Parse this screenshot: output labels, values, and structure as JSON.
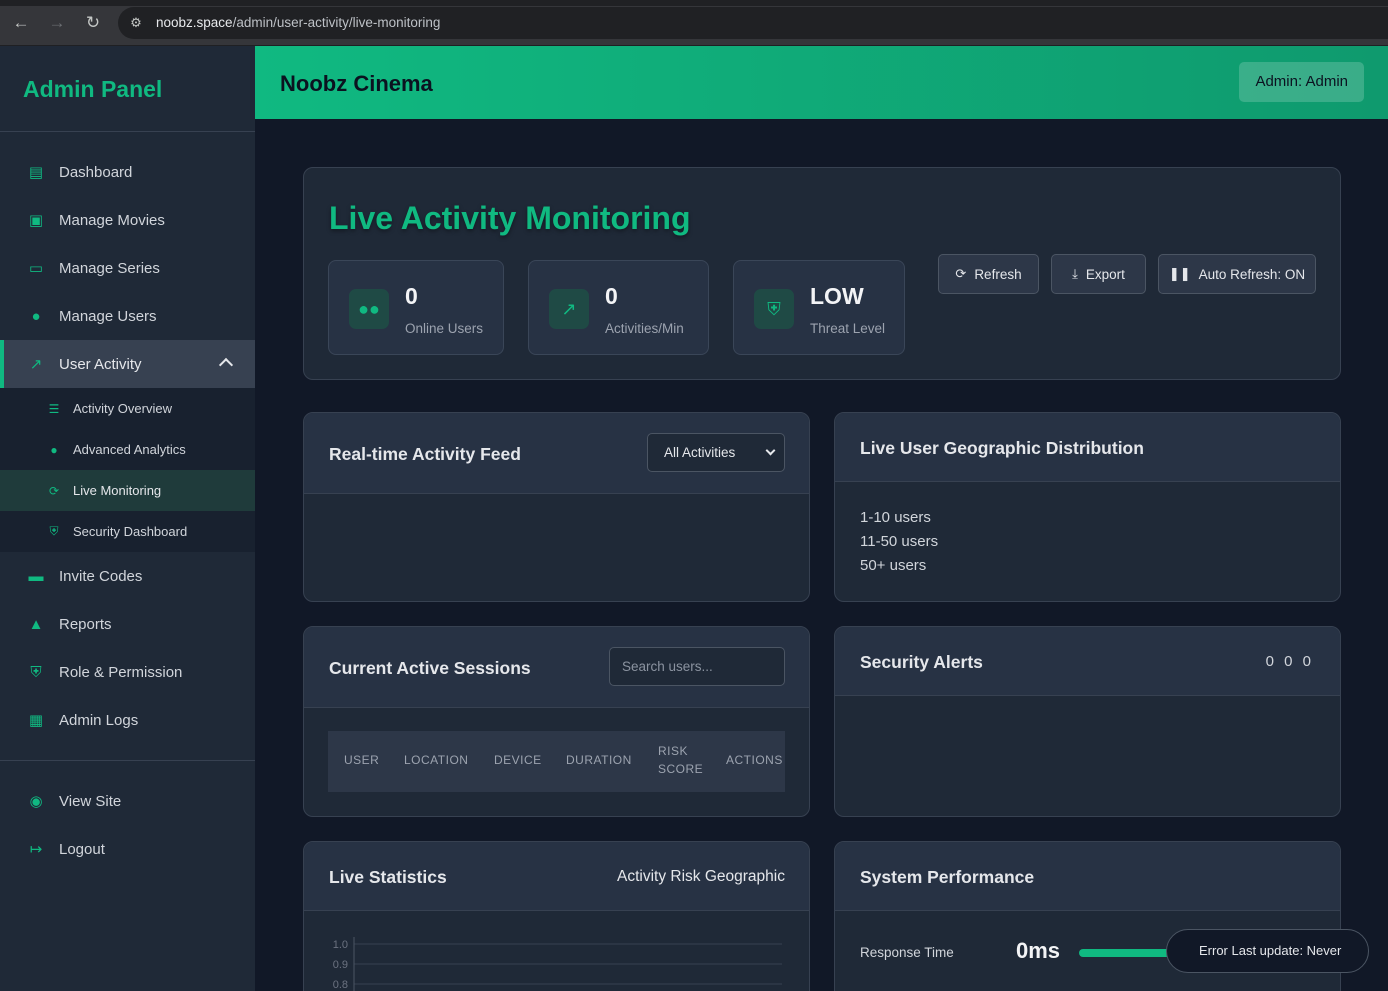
{
  "browser": {
    "url_host": "noobz.space",
    "url_path": "/admin/user-activity/live-monitoring"
  },
  "sidebar": {
    "title": "Admin Panel",
    "items": [
      {
        "label": "Dashboard",
        "icon": "chart-icon"
      },
      {
        "label": "Manage Movies",
        "icon": "film-icon"
      },
      {
        "label": "Manage Series",
        "icon": "tv-icon"
      },
      {
        "label": "Manage Users",
        "icon": "users-icon"
      },
      {
        "label": "User Activity",
        "icon": "activity-icon"
      },
      {
        "label": "Invite Codes",
        "icon": "ticket-icon"
      },
      {
        "label": "Reports",
        "icon": "warning-icon"
      },
      {
        "label": "Role & Permission",
        "icon": "shield-icon"
      },
      {
        "label": "Admin Logs",
        "icon": "clipboard-icon"
      },
      {
        "label": "View Site",
        "icon": "globe-icon"
      },
      {
        "label": "Logout",
        "icon": "logout-icon"
      }
    ],
    "subitems": [
      {
        "label": "Activity Overview"
      },
      {
        "label": "Advanced Analytics"
      },
      {
        "label": "Live Monitoring"
      },
      {
        "label": "Security Dashboard"
      }
    ]
  },
  "header": {
    "brand": "Noobz Cinema",
    "admin_label": "Admin: Admin"
  },
  "monitor": {
    "title": "Live Activity Monitoring",
    "stats": [
      {
        "value": "0",
        "label": "Online Users"
      },
      {
        "value": "0",
        "label": "Activities/Min"
      },
      {
        "value": "LOW",
        "label": "Threat Level"
      }
    ],
    "buttons": {
      "refresh": "Refresh",
      "export": "Export",
      "auto_refresh": "Auto Refresh: ON"
    }
  },
  "feed": {
    "title": "Real-time Activity Feed",
    "filter_value": "All Activities"
  },
  "geo": {
    "title": "Live User Geographic Distribution",
    "legend": [
      "1-10 users",
      "11-50 users",
      "50+ users"
    ]
  },
  "sessions": {
    "title": "Current Active Sessions",
    "search_placeholder": "Search users...",
    "columns": [
      "USER",
      "LOCATION",
      "DEVICE",
      "DURATION",
      "RISK",
      "SCORE",
      "ACTIONS"
    ]
  },
  "alerts": {
    "title": "Security Alerts",
    "counts": "0 0 0"
  },
  "live_stats": {
    "title": "Live Statistics",
    "tabs": "Activity Risk Geographic",
    "y_ticks": [
      "1.0",
      "0.9",
      "0.8"
    ]
  },
  "performance": {
    "title": "System Performance",
    "metric_label": "Response Time",
    "metric_value": "0ms"
  },
  "toast": {
    "text": "Error  Last update: Never"
  }
}
